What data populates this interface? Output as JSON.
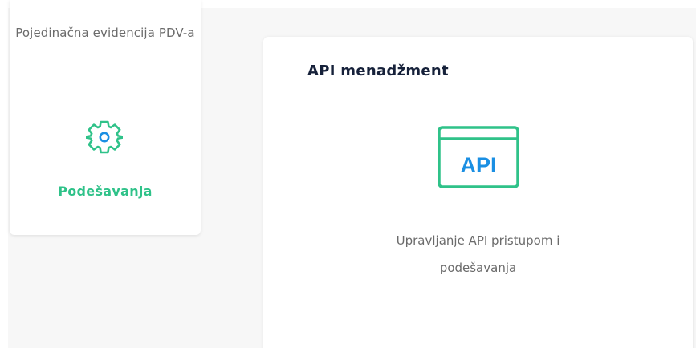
{
  "sidebar": {
    "previous_item_label": "Pojedinačna evidencija PDV-a",
    "settings_label": "Podešavanja",
    "settings_icon": "gear-icon"
  },
  "card": {
    "title": "API menadžment",
    "icon": "api-window-icon",
    "icon_text": "API",
    "description": "Upravljanje API pristupom i podešavanja"
  },
  "colors": {
    "accent": "#2fc289",
    "api_blue": "#1a8fe3",
    "title_text": "#16213a",
    "muted_text": "#6b6b6b",
    "background": "#f7f7f7"
  }
}
